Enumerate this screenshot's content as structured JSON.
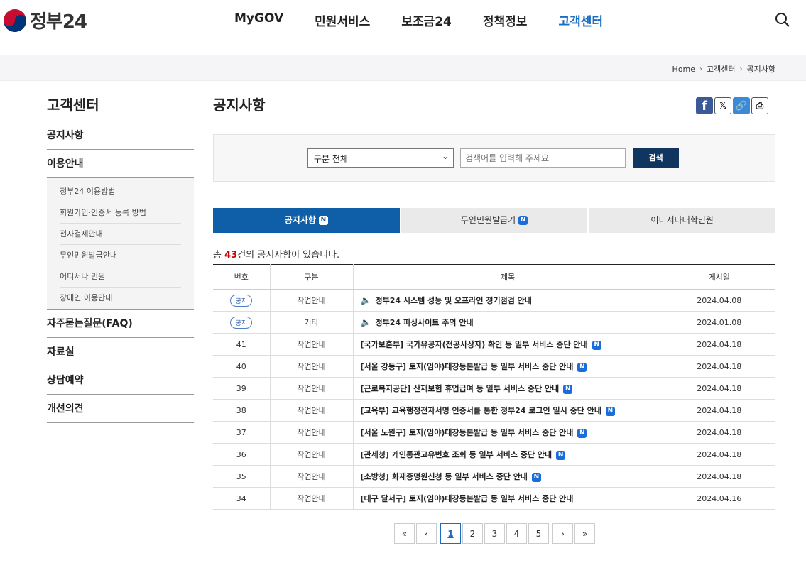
{
  "header": {
    "logo_text": "정부24",
    "nav": [
      "MyGOV",
      "민원서비스",
      "보조금24",
      "정책정보",
      "고객센터"
    ],
    "active_nav": "고객센터"
  },
  "breadcrumb": [
    "Home",
    "고객센터",
    "공지사항"
  ],
  "lnb": {
    "title": "고객센터",
    "items": [
      {
        "label": "공지사항"
      },
      {
        "label": "이용안내",
        "sub": [
          "정부24 이용방법",
          "회원가입·인증서 등록 방법",
          "전자결제안내",
          "무인민원발급안내",
          "어디서나 민원",
          "장애인 이용안내"
        ]
      },
      {
        "label": "자주묻는질문(FAQ)"
      },
      {
        "label": "자료실"
      },
      {
        "label": "상담예약"
      },
      {
        "label": "개선의견"
      }
    ]
  },
  "content": {
    "title": "공지사항",
    "share": {
      "facebook": "f",
      "x": "𝕏",
      "link": "🔗",
      "print": "⎙"
    },
    "search": {
      "select_value": "구분 전체",
      "placeholder": "검색어를 입력해 주세요",
      "button": "검색"
    },
    "tabs": [
      {
        "label": "공지사항",
        "badge": "N"
      },
      {
        "label": "무인민원발급기",
        "badge": "N"
      },
      {
        "label": "어디서나대학민원",
        "badge": ""
      }
    ],
    "total": {
      "prefix": "총 ",
      "count": "43",
      "suffix": "건의 공지사항이 있습니다."
    },
    "table": {
      "headers": [
        "번호",
        "구분",
        "제목",
        "게시일"
      ],
      "rows": [
        {
          "no": "공지",
          "cat": "작업안내",
          "title": "정부24 시스템 성능 및 오프라인 정기점검 안내",
          "date": "2024.04.08",
          "notice": true,
          "new": false
        },
        {
          "no": "공지",
          "cat": "기타",
          "title": "정부24 피싱사이트 주의 안내",
          "date": "2024.01.08",
          "notice": true,
          "new": false
        },
        {
          "no": "41",
          "cat": "작업안내",
          "title": "[국가보훈부] 국가유공자(전공사상자) 확인 등 일부 서비스 중단 안내",
          "date": "2024.04.18",
          "notice": false,
          "new": true
        },
        {
          "no": "40",
          "cat": "작업안내",
          "title": "[서울 강동구] 토지(임야)대장등본발급 등 일부 서비스 중단 안내",
          "date": "2024.04.18",
          "notice": false,
          "new": true
        },
        {
          "no": "39",
          "cat": "작업안내",
          "title": "[근로복지공단] 산재보험 휴업급여 등 일부 서비스 중단 안내",
          "date": "2024.04.18",
          "notice": false,
          "new": true
        },
        {
          "no": "38",
          "cat": "작업안내",
          "title": "[교육부] 교육행정전자서명 인증서를 통한 정부24 로그인 일시 중단 안내",
          "date": "2024.04.18",
          "notice": false,
          "new": true
        },
        {
          "no": "37",
          "cat": "작업안내",
          "title": "[서울 노원구] 토지(임야)대장등본발급 등 일부 서비스 중단 안내",
          "date": "2024.04.18",
          "notice": false,
          "new": true
        },
        {
          "no": "36",
          "cat": "작업안내",
          "title": "[관세청] 개인통관고유번호 조회 등 일부 서비스 중단 안내",
          "date": "2024.04.18",
          "notice": false,
          "new": true
        },
        {
          "no": "35",
          "cat": "작업안내",
          "title": "[소방청] 화재증명원신청 등 일부 서비스 중단 안내",
          "date": "2024.04.18",
          "notice": false,
          "new": true
        },
        {
          "no": "34",
          "cat": "작업안내",
          "title": "[대구 달서구] 토지(임야)대장등본발급 등 일부 서비스 중단 안내",
          "date": "2024.04.16",
          "notice": false,
          "new": false
        }
      ]
    },
    "pager": {
      "first": "«",
      "prev": "‹",
      "pages": [
        "1",
        "2",
        "3",
        "4",
        "5"
      ],
      "current": "1",
      "next": "›",
      "last": "»"
    }
  },
  "colors": {
    "accent": "#1b6dc1",
    "tab_active": "#0f5ea8",
    "search_button": "#10365f",
    "count": "#cc0000"
  }
}
